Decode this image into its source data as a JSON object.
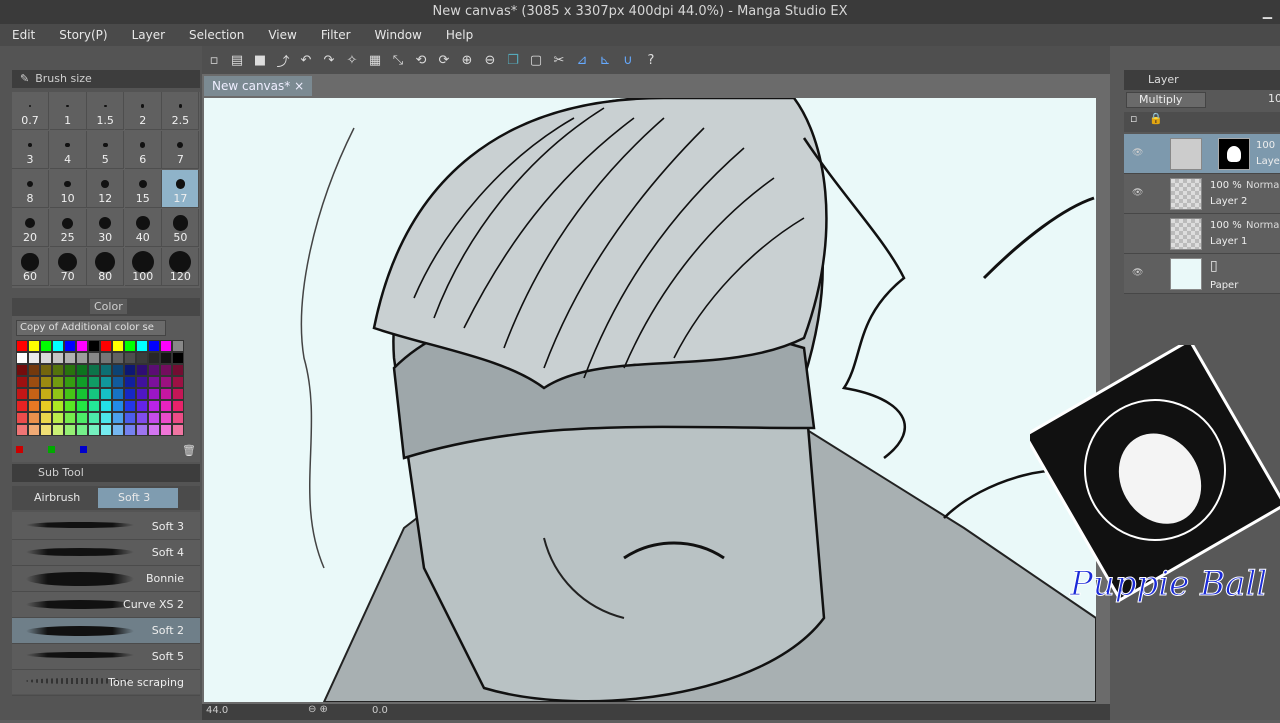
{
  "window": {
    "title": "New canvas* (3085 x 3307px 400dpi 44.0%)  - Manga Studio EX"
  },
  "menu": [
    "Edit",
    "Story(P)",
    "Layer",
    "Selection",
    "View",
    "Filter",
    "Window",
    "Help"
  ],
  "brush_size": {
    "header": "Brush size",
    "sizes": [
      "0.7",
      "1",
      "1.5",
      "2",
      "2.5",
      "3",
      "4",
      "5",
      "6",
      "7",
      "8",
      "10",
      "12",
      "15",
      "17",
      "20",
      "25",
      "30",
      "40",
      "50",
      "60",
      "70",
      "80",
      "100",
      "120"
    ],
    "selected": "17"
  },
  "color": {
    "tab": "Color",
    "set_name": "Copy of Additional color se"
  },
  "sub_tool": {
    "header": "Sub Tool",
    "tabs": [
      "Airbrush",
      "Soft 3"
    ],
    "brushes": [
      "Soft 3",
      "Soft 4",
      "Bonnie",
      "Curve XS 2",
      "Soft 2",
      "Soft 5",
      "Tone scraping"
    ],
    "selected": "Soft 2"
  },
  "document": {
    "tab": "New canvas*"
  },
  "status": {
    "zoom": "44.0",
    "angle": "0.0"
  },
  "layers": {
    "header": "Layer",
    "blend_mode": "Multiply",
    "opacity_partial": "10",
    "items": [
      {
        "pct": "100",
        "mode": "",
        "name": "Laye",
        "selected": true
      },
      {
        "pct": "100 %",
        "mode": "Normal",
        "name": "Layer 2",
        "selected": false
      },
      {
        "pct": "100 %",
        "mode": "Normal",
        "name": "Layer 1",
        "selected": false
      },
      {
        "pct": "",
        "mode": "",
        "name": "Paper",
        "selected": false
      }
    ]
  },
  "watermark": {
    "text": "Puppie Ball"
  },
  "colors": {
    "selection": "#8fb3c9",
    "canvas_bg": "#eaf9f9",
    "layer_selected": "#7d99ad"
  }
}
